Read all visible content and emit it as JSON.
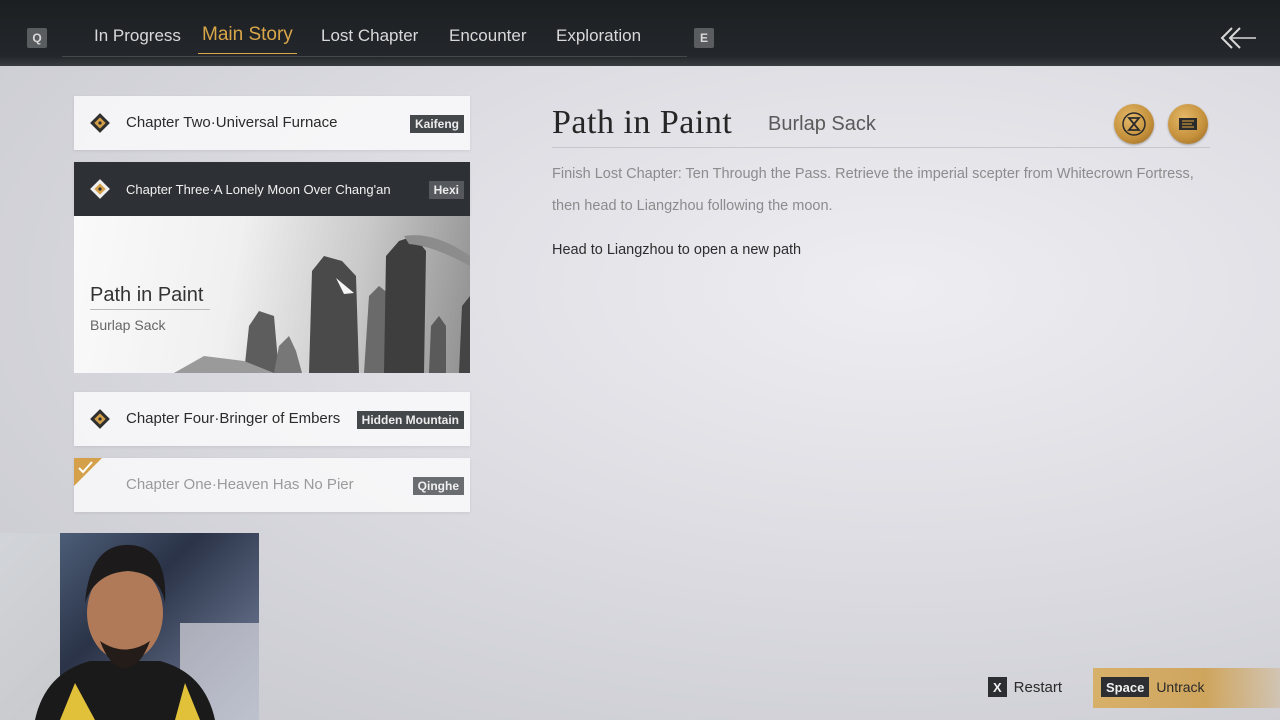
{
  "header": {
    "left_key": "Q",
    "right_key": "E",
    "tabs": [
      {
        "label": "In Progress"
      },
      {
        "label": "Main Story"
      },
      {
        "label": "Lost Chapter"
      },
      {
        "label": "Encounter"
      },
      {
        "label": "Exploration"
      }
    ],
    "active_tab": "Main Story",
    "back_icon": "double-chevron-left-icon"
  },
  "chapters": [
    {
      "title": "Chapter Two·Universal Furnace",
      "region": "Kaifeng",
      "state": "normal"
    },
    {
      "title": "Chapter Three·A Lonely Moon Over Chang'an",
      "region": "Hexi",
      "state": "selected"
    },
    {
      "title": "Chapter Four·Bringer of Embers",
      "region": "Hidden Mountain",
      "state": "normal"
    },
    {
      "title": "Chapter One·Heaven Has No Pier",
      "region": "Qinghe",
      "state": "completed"
    }
  ],
  "feature": {
    "title": "Path in Paint",
    "subtitle": "Burlap Sack"
  },
  "detail": {
    "title": "Path in Paint",
    "subtitle": "Burlap Sack",
    "description": "Finish Lost Chapter: Ten Through the Pass. Retrieve the imperial scepter from Whitecrown Fortress, then head to Liangzhou following the moon.",
    "objective": "Head to Liangzhou to open a new path",
    "icons": [
      "hourglass-icon",
      "banner-icon"
    ]
  },
  "footer": {
    "restart_key": "X",
    "restart_label": "Restart",
    "untrack_key": "Space",
    "untrack_label": "Untrack"
  },
  "colors": {
    "accent_gold": "#d9a64a",
    "topbar": "#23272b",
    "tag_bg": "#45484b"
  }
}
